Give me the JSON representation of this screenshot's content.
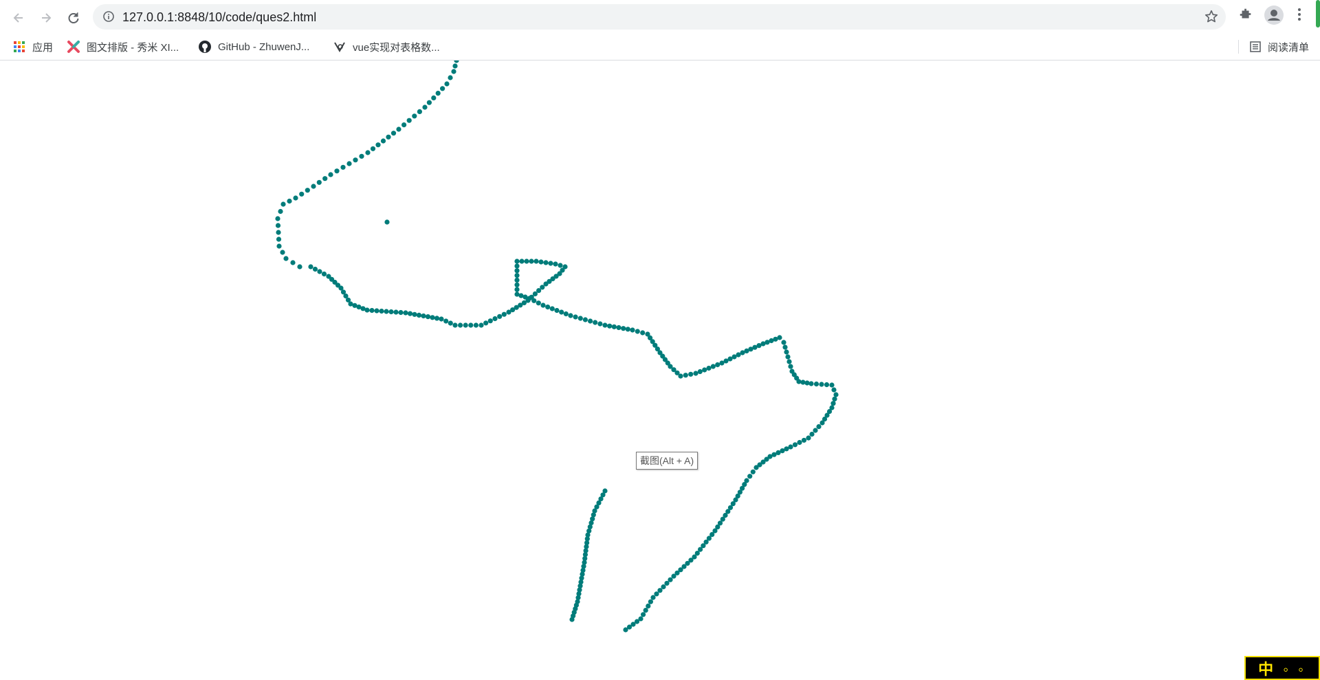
{
  "browser": {
    "url": "127.0.0.1:8848/10/code/ques2.html",
    "icons": [
      "back-arrow-icon",
      "forward-arrow-icon",
      "reload-icon",
      "info-icon",
      "star-icon",
      "extensions-icon",
      "profile-icon",
      "menu-icon"
    ]
  },
  "bookmarks": [
    {
      "label": "应用",
      "icon": "apps-grid-icon"
    },
    {
      "label": "图文排版 - 秀米 XI...",
      "icon": "xiumi-icon"
    },
    {
      "label": "GitHub - ZhuwenJ...",
      "icon": "github-icon"
    },
    {
      "label": "vue实现对表格数...",
      "icon": "vue-site-icon"
    }
  ],
  "reading_list": {
    "label": "阅读清单",
    "icon": "reading-list-icon"
  },
  "tooltip": {
    "text": "截图(Alt + A)"
  },
  "ime": {
    "text": "中 ◦ ◦"
  },
  "colors": {
    "point": "#007c7a",
    "accent": "#1a73e8"
  }
}
